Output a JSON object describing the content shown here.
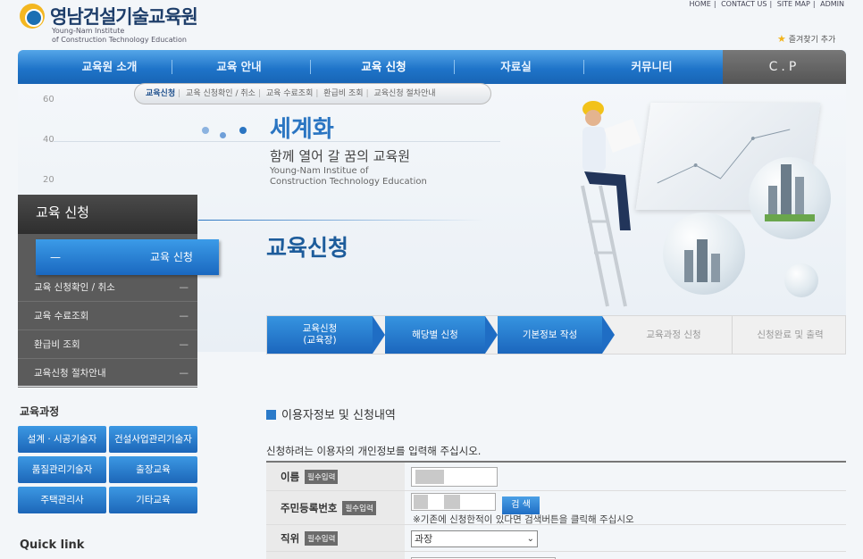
{
  "header": {
    "title": "영남건설기술교육원",
    "subtitle_1": "Young-Nam Institute",
    "subtitle_2": "of Construction Technology Education",
    "top_links": [
      "HOME",
      "CONTACT US",
      "SITE MAP",
      "ADMIN"
    ],
    "bookmark": "즐겨찾기 추가"
  },
  "nav": {
    "items": [
      "교육원 소개",
      "교육 안내",
      "교육 신청",
      "자료실",
      "커뮤니티"
    ],
    "cp": "C.P",
    "sub": [
      "교육신청",
      "교육 신청확인 / 취소",
      "교육 수료조회",
      "환급비 조회",
      "교육신청 절차안내"
    ]
  },
  "hero": {
    "ruler": [
      "60",
      "40",
      "20"
    ],
    "title": "세계화",
    "slogan": "함께 열어 갈 꿈의 교육원",
    "en_1": "Young-Nam Institue of",
    "en_2": "Construction Technology Education",
    "page_heading": "교육신청"
  },
  "sidebar": {
    "title": "교육 신청",
    "active": "교육 신청",
    "active_dash": "—",
    "items": [
      "교육 신청확인 / 취소",
      "교육 수료조회",
      "환급비 조회",
      "교육신청 절차안내"
    ],
    "dash": "—",
    "course_title": "교육과정",
    "courses": [
      "설계 · 시공기술자",
      "건설사업관리기술자",
      "품질관리기술자",
      "출장교육",
      "주택관리사",
      "기타교육"
    ],
    "quick_link": "Quick link"
  },
  "steps": [
    {
      "label": "교육신청\n(교육장)",
      "state": "done"
    },
    {
      "label": "해당별 신청",
      "state": "done"
    },
    {
      "label": "기본정보 작성",
      "state": "done"
    },
    {
      "label": "교육과정 신청",
      "state": "todo"
    },
    {
      "label": "신청완료 및 출력",
      "state": "todo"
    }
  ],
  "form": {
    "section_title": "이용자정보 및 신청내역",
    "intro": "신청하려는 이용자의 개인정보를 입력해 주십시오.",
    "required": "필수입력",
    "name_label": "이름",
    "ssn_label": "주민등록번호",
    "search_btn": "검 색",
    "hint": "※기존에 신청한적이 있다면 검색버튼을 클릭해 주십시오",
    "position_label": "직위",
    "position_value": "과장",
    "chevron": "⌄"
  },
  "colors": {
    "accent": "#1f74c9",
    "dark": "#4a4a4a"
  }
}
